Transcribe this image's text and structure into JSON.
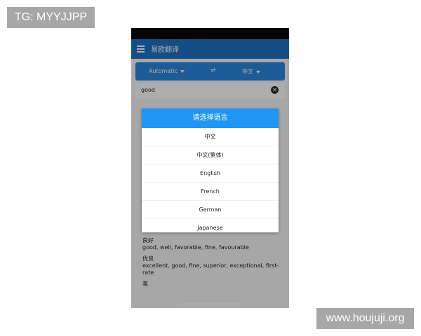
{
  "watermark": {
    "tag": "TG: MYYJJPP",
    "site": "www.houjuji.org"
  },
  "app": {
    "title": "易欧翻译"
  },
  "languages": {
    "source": "Automatic",
    "target": "中文"
  },
  "input": {
    "text": "good"
  },
  "dialog": {
    "title": "请选择语言",
    "options": [
      "中文",
      "中文(繁体)",
      "English",
      "French",
      "German",
      "Japanese"
    ]
  },
  "results": [
    {
      "word": "",
      "meaning": "good"
    },
    {
      "word": "良好",
      "meaning": "good, well, favorable, fine, favourable"
    },
    {
      "word": "优良",
      "meaning": "excellent, good, fine, superior, exceptional, first-rate"
    },
    {
      "word": "美",
      "meaning": ""
    }
  ],
  "colors": {
    "appbar": "#1f73c8",
    "langbar": "#2b86dd",
    "dialog_header": "#2196f3"
  }
}
